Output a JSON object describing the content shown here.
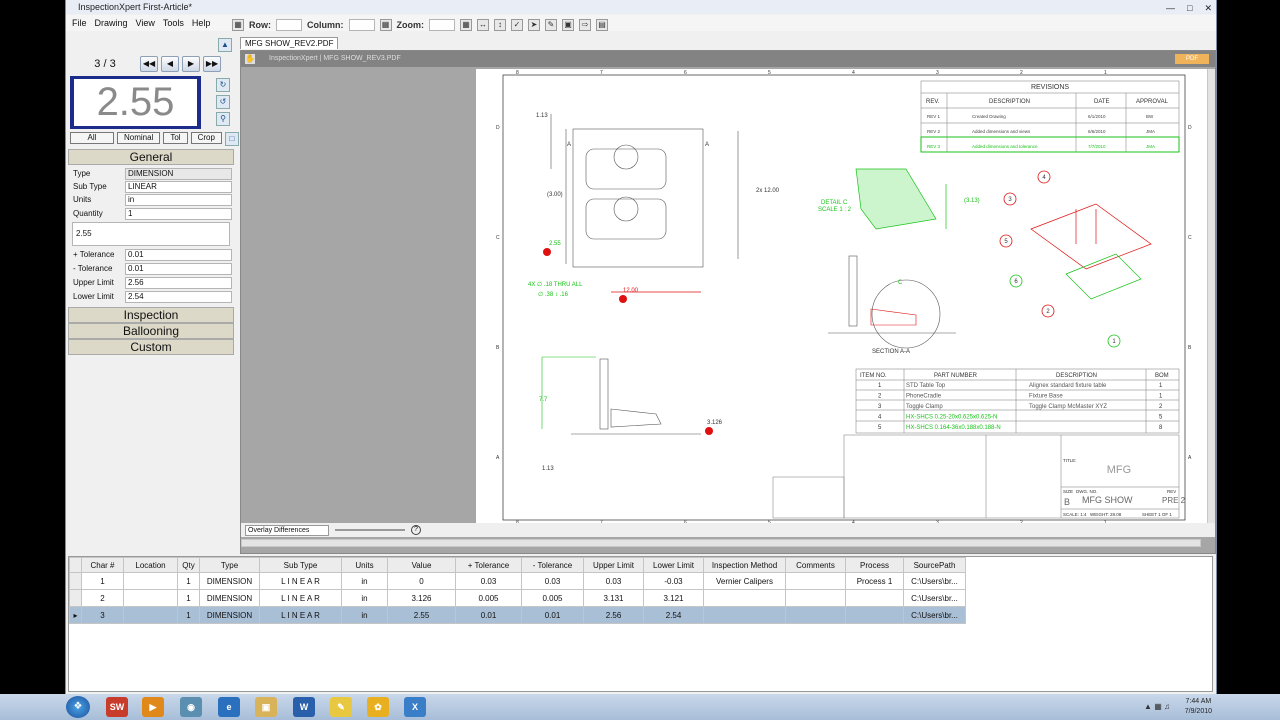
{
  "window": {
    "title": "InspectionXpert First-Article*"
  },
  "menu": [
    "File",
    "Drawing",
    "View",
    "Tools",
    "Help"
  ],
  "toolbar": {
    "row_label": "Row:",
    "column_label": "Column:",
    "zoom_label": "Zoom:"
  },
  "document_tab": "MFG SHOW_REV2.PDF",
  "viewer": {
    "title": "InspectionXpert | MFG SHOW_REV3.PDF",
    "overlay_option": "Overlay Differences"
  },
  "nav": {
    "page_counter": "3 / 3"
  },
  "big_value": "2.55",
  "filters": [
    "All",
    "Nominal",
    "Tol",
    "Crop"
  ],
  "sections": {
    "general": "General",
    "inspection": "Inspection",
    "ballooning": "Ballooning",
    "custom": "Custom"
  },
  "properties": {
    "type_label": "Type",
    "type_value": "DIMENSION",
    "subtype_label": "Sub Type",
    "subtype_value": "LINEAR",
    "units_label": "Units",
    "units_value": "in",
    "quantity_label": "Quantity",
    "quantity_value": "1",
    "value_text": "2.55",
    "plus_tol_label": "+ Tolerance",
    "plus_tol_value": "0.01",
    "minus_tol_label": "- Tolerance",
    "minus_tol_value": "0.01",
    "upper_label": "Upper Limit",
    "upper_value": "2.56",
    "lower_label": "Lower Limit",
    "lower_value": "2.54"
  },
  "grid": {
    "headers": [
      "Char #",
      "Location",
      "Qty",
      "Type",
      "Sub Type",
      "Units",
      "Value",
      "+ Tolerance",
      "- Tolerance",
      "Upper Limit",
      "Lower Limit",
      "Inspection Method",
      "Comments",
      "Process",
      "SourcePath"
    ],
    "rows": [
      {
        "char": "1",
        "location": "",
        "qty": "1",
        "type": "DIMENSION",
        "subtype": "L I N E A R",
        "units": "in",
        "value": "0",
        "plus": "0.03",
        "minus": "0.03",
        "upper": "0.03",
        "lower": "-0.03",
        "method": "Vernier Calipers",
        "comments": "",
        "process": "Process 1",
        "source": "C:\\Users\\br..."
      },
      {
        "char": "2",
        "location": "",
        "qty": "1",
        "type": "DIMENSION",
        "subtype": "L I N E A R",
        "units": "in",
        "value": "3.126",
        "plus": "0.005",
        "minus": "0.005",
        "upper": "3.131",
        "lower": "3.121",
        "method": "",
        "comments": "",
        "process": "",
        "source": "C:\\Users\\br..."
      },
      {
        "char": "3",
        "location": "",
        "qty": "1",
        "type": "DIMENSION",
        "subtype": "L I N E A R",
        "units": "in",
        "value": "2.55",
        "plus": "0.01",
        "minus": "0.01",
        "upper": "2.56",
        "lower": "2.54",
        "method": "",
        "comments": "",
        "process": "",
        "source": "C:\\Users\\br..."
      }
    ]
  },
  "drawing": {
    "revisions_title": "REVISIONS",
    "rev_headers": [
      "REV.",
      "DESCRIPTION",
      "DATE",
      "APPROVAL"
    ],
    "revisions": [
      {
        "rev": "REV 1",
        "desc": "Created Drawing",
        "date": "6/1/2010",
        "appr": "BW"
      },
      {
        "rev": "REV 2",
        "desc": "Added dimensions and views",
        "date": "6/6/2010",
        "appr": "JMA"
      },
      {
        "rev": "REV 3",
        "desc": "Added dimensions and tolerance",
        "date": "7/7/2010",
        "appr": "JMA"
      }
    ],
    "bom_headers": [
      "ITEM NO.",
      "PART NUMBER",
      "DESCRIPTION",
      "BOM"
    ],
    "bom": [
      {
        "item": "1",
        "part": "STD Table Top",
        "desc": "Alignex standard fixture table",
        "qty": "1"
      },
      {
        "item": "2",
        "part": "PhoneCradle",
        "desc": "Fixture Base",
        "qty": "1"
      },
      {
        "item": "3",
        "part": "Toggle Clamp",
        "desc": "Toggle Clamp McMaster XYZ",
        "qty": "2"
      },
      {
        "item": "4",
        "part": "HX-SHCS 0.25-20x0.625x0.625-N",
        "desc": "",
        "qty": "5"
      },
      {
        "item": "5",
        "part": "HX-SHCS 0.164-36x0.188x0.188-N",
        "desc": "",
        "qty": "8"
      }
    ],
    "title_block": {
      "company": "MFG",
      "drawing_name": "MFG SHOW",
      "size": "B",
      "rev": "PRE 2",
      "scale": "SCALE: 1:4",
      "weight": "WEIGHT: 28.08",
      "sheet": "SHEET 1 OF 1",
      "size_label": "SIZE",
      "dwg_label": "DWG. NO.",
      "rev_label": "REV",
      "title_label": "TITLE:"
    },
    "dims": {
      "d1": "1.13",
      "d2": "(3.00)",
      "d3": "2x 12.00",
      "d4": "2.55",
      "d5": "12.00",
      "d6": "4X ∅ .18 THRU ALL",
      "d7": "∅ .38 ↕ .16",
      "d8": "7.7",
      "d9": "3.126",
      "d10": "1.13",
      "d11": "(3.13)"
    },
    "labels": {
      "detail": "DETAIL C",
      "detail_scale": "SCALE 1 : 2",
      "section": "SECTION A-A",
      "sec_a": "A",
      "c_label": "C"
    },
    "balloons": [
      "1",
      "2",
      "3",
      "4",
      "5",
      "6"
    ],
    "border_cols": [
      "8",
      "7",
      "6",
      "5",
      "4",
      "3",
      "2",
      "1"
    ],
    "border_rows": [
      "D",
      "C",
      "B",
      "A"
    ]
  },
  "taskbar": {
    "time": "7:44 AM",
    "date": "7/9/2010"
  },
  "colors": {
    "accent": "#1b2c8a",
    "green": "#19c219",
    "red": "#e01010",
    "selected_row": "#a9bfd6"
  }
}
